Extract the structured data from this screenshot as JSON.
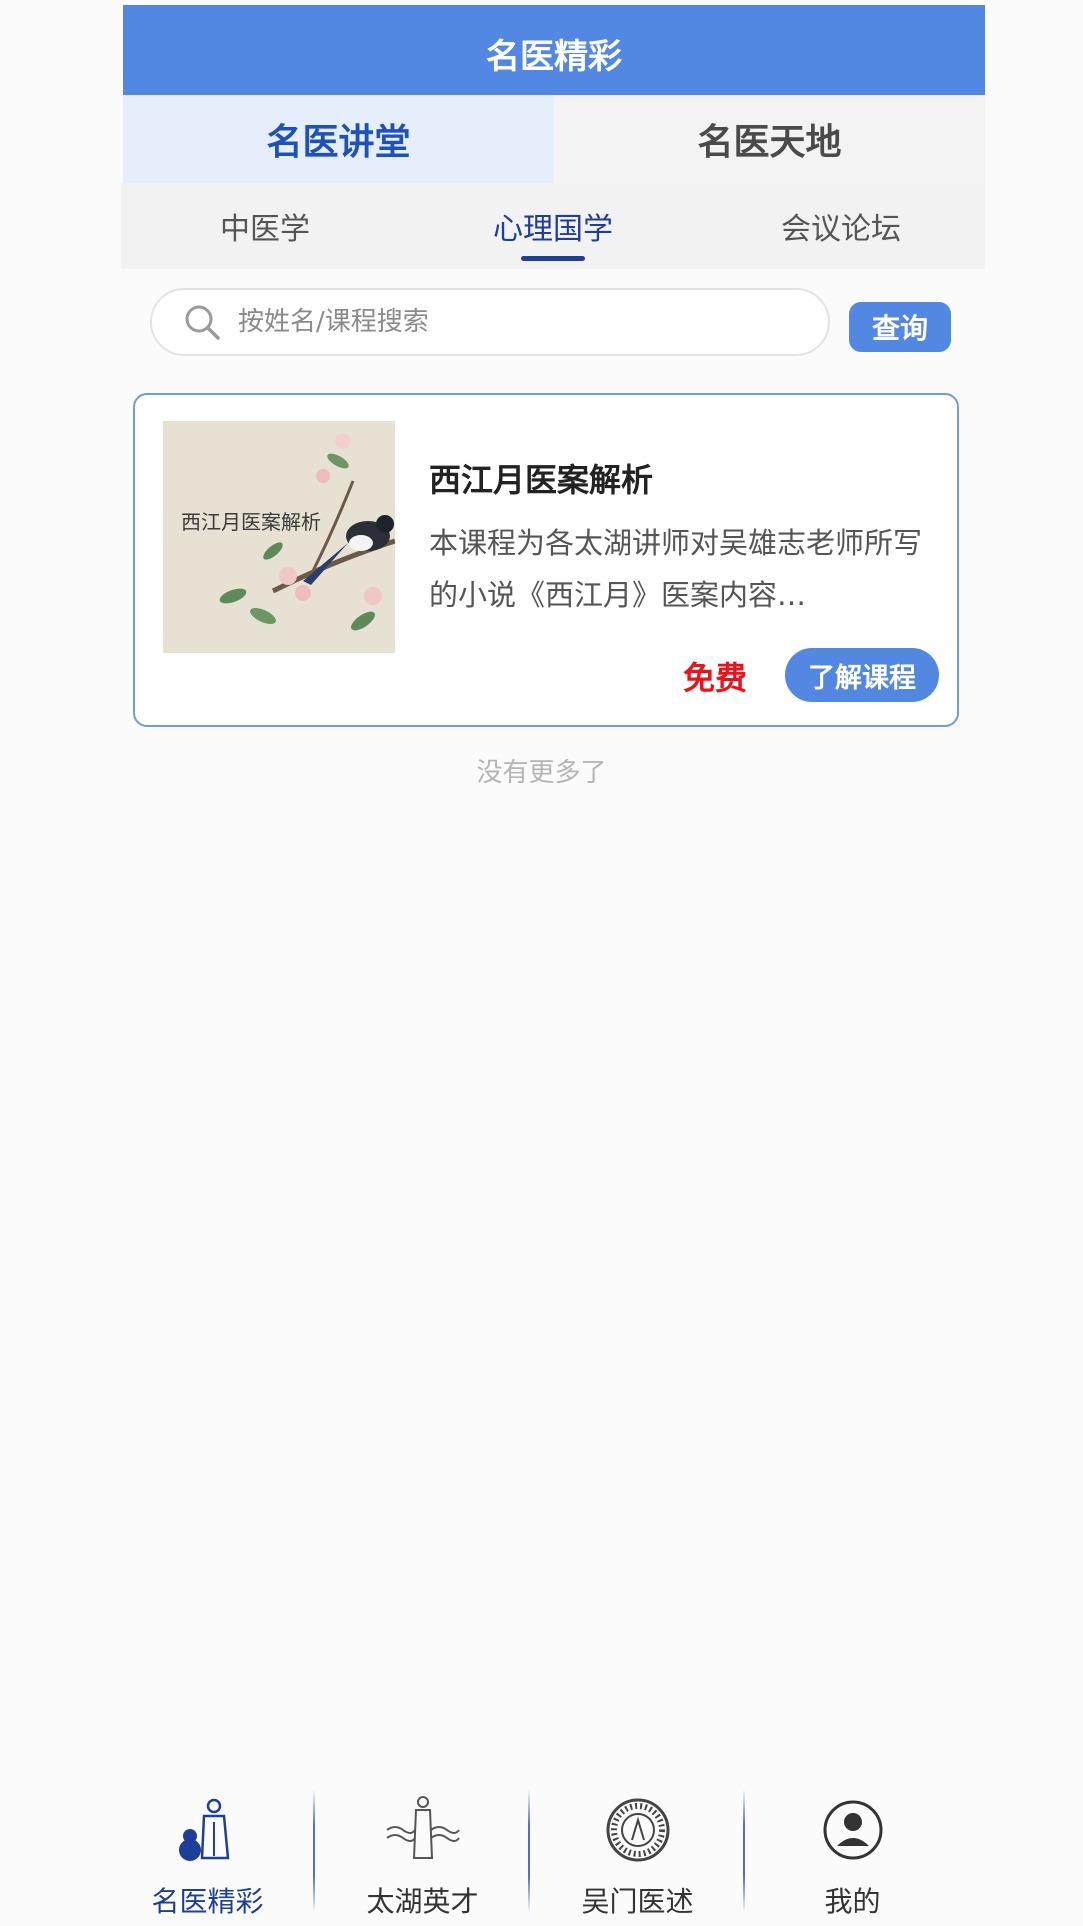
{
  "header": {
    "title": "名医精彩"
  },
  "main_tabs": [
    {
      "label": "名医讲堂",
      "active": true
    },
    {
      "label": "名医天地",
      "active": false
    }
  ],
  "sub_tabs": [
    {
      "label": "中医学",
      "active": false
    },
    {
      "label": "心理国学",
      "active": true
    },
    {
      "label": "会议论坛",
      "active": false
    }
  ],
  "search": {
    "placeholder": "按姓名/课程搜索",
    "value": "",
    "button_label": "查询"
  },
  "courses": [
    {
      "thumbnail_text": "西江月医案解析",
      "title": "西江月医案解析",
      "description": "本课程为各太湖讲师对吴雄志老师所写的小说《西江月》医案内容…",
      "price": "免费",
      "button_label": "了解课程"
    }
  ],
  "list_end_text": "没有更多了",
  "bottom_nav": [
    {
      "label": "名医精彩",
      "icon": "doctor-gourd-icon",
      "active": true
    },
    {
      "label": "太湖英才",
      "icon": "figure-waves-icon",
      "active": false
    },
    {
      "label": "吴门医述",
      "icon": "emblem-seal-icon",
      "active": false
    },
    {
      "label": "我的",
      "icon": "user-profile-icon",
      "active": false
    }
  ],
  "colors": {
    "primary": "#5288e2",
    "accent_dark": "#1f3f96",
    "price_red": "#e8141b"
  }
}
